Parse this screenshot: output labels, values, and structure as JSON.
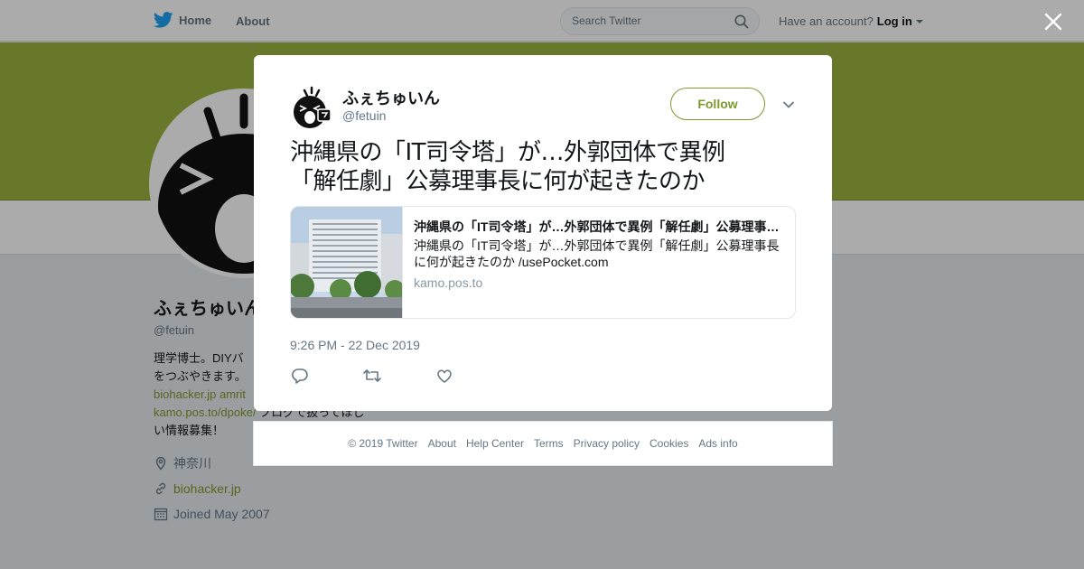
{
  "nav": {
    "home_label": "Home",
    "about_label": "About",
    "search_placeholder": "Search Twitter",
    "have_account": "Have an account?",
    "login_label": "Log in"
  },
  "colors": {
    "link": "#7e9a2d",
    "banner": "#9ab33f",
    "twitter_blue": "#1da1f2"
  },
  "profile": {
    "name": "ふぇちゅいん",
    "handle": "@fetuin",
    "bio_line1": "理学博士。DIYバ",
    "bio_line2": "をつぶやきます。",
    "bio_link1": "biohacker.jp amrit",
    "bio_link2": "kamo.pos.to/dpoke/",
    "bio_line3_tail": " ブログで扱ってほし",
    "bio_line4": "い情報募集！",
    "location": "神奈川",
    "website": "biohacker.jp",
    "joined": "Joined May 2007"
  },
  "tweet": {
    "author_name": "ふぇちゅいん",
    "author_handle": "@fetuin",
    "follow_label": "Follow",
    "text_line1": "沖縄県の「IT司令塔」が…外郭団体で異例",
    "text_line2": "「解任劇」公募理事長に何が起きたのか",
    "card": {
      "title": "沖縄県の「IT司令塔」が…外郭団体で異例「解任劇」公募理事長に何が起きたのか",
      "description": "沖縄県の「IT司令塔」が…外郭団体で異例「解任劇」公募理事長に何が起きたのか /usePocket.com",
      "domain": "kamo.pos.to"
    },
    "timestamp": "9:26 PM - 22 Dec 2019",
    "actions": [
      "reply-icon",
      "retweet-icon",
      "like-icon"
    ]
  },
  "footer": {
    "links": [
      "© 2019 Twitter",
      "About",
      "Help Center",
      "Terms",
      "Privacy policy",
      "Cookies",
      "Ads info"
    ]
  }
}
